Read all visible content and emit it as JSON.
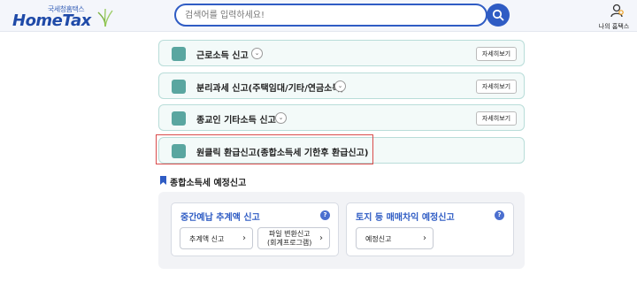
{
  "header": {
    "logo_small": "국세청홈택스",
    "logo_main": "HomeTax",
    "search_placeholder": "검색어를 입력하세요!",
    "mytax_label": "나의 홈택스"
  },
  "rows": [
    {
      "label": "근로소득 신고",
      "detail": "자세히보기"
    },
    {
      "label": "분리과세 신고(주택임대/기타/연금소득)",
      "detail": "자세히보기"
    },
    {
      "label": "종교인 기타소득 신고",
      "detail": "자세히보기"
    },
    {
      "label": "원클릭 환급신고(종합소득세 기한후 환급신고)"
    }
  ],
  "section": {
    "title": "종합소득세 예정신고",
    "cards": [
      {
        "title": "중간예납 추계액 신고",
        "buttons": [
          {
            "label": "추계액 신고"
          },
          {
            "label_line1": "파일 변환신고",
            "label_line2": "(회계프로그램)"
          }
        ]
      },
      {
        "title": "토지 등 매매차익 예정신고",
        "buttons": [
          {
            "label": "예정신고"
          }
        ]
      }
    ]
  },
  "colors": {
    "brand": "#2f5cc4",
    "row_border": "#b9ddd9",
    "highlight": "#d94b4b"
  }
}
